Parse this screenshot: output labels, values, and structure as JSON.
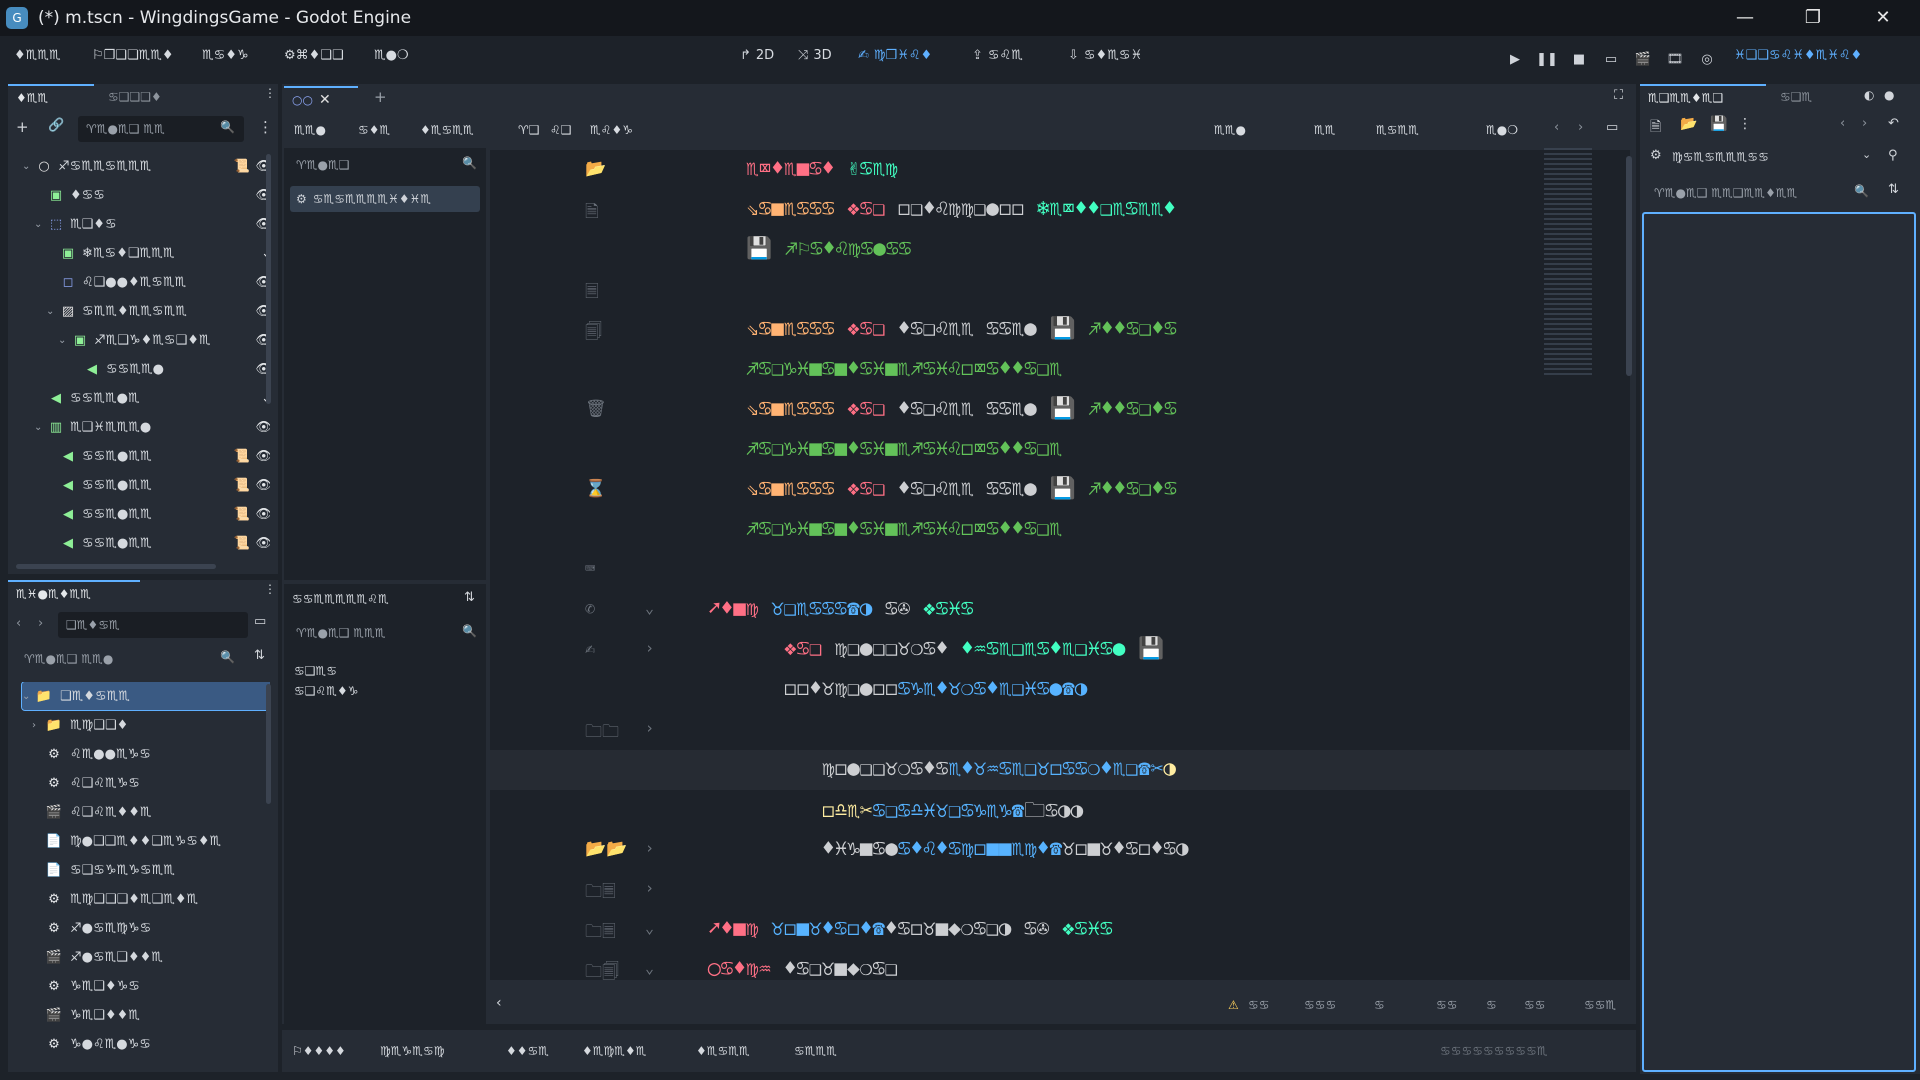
{
  "window": {
    "title": "(*) m.tscn - WingdingsGame - Godot Engine",
    "app_icon": "godot-icon",
    "controls": {
      "minimize": "—",
      "maximize": "❐",
      "close": "✕"
    }
  },
  "menubar": {
    "menus": [
      "♦♏♏♏",
      "⚐❒❑❏♏♏♦",
      "♏♋♦♑",
      "⚙⌘♦❑❑",
      "♏●❍"
    ],
    "workspaces": [
      {
        "icon": "↱",
        "label": "2D"
      },
      {
        "icon": "⤨",
        "label": "3D"
      },
      {
        "icon": "✍",
        "label": "♍❒♓♌♦"
      },
      {
        "icon": "⇪",
        "label": "♋♌♏"
      },
      {
        "icon": "⇩",
        "label": "♋♦♏♋♓"
      }
    ],
    "renderer": "♓❑❑♋♌♓♦♏♓♌♦"
  },
  "colors": {
    "accent": "#5fb0ff",
    "keyword": "#ff7085",
    "string": "#ffeda1",
    "func": "#57b3ff",
    "type": "#42ffc2",
    "orange": "#ffb373",
    "green": "#63c259",
    "comment": "#7b838d"
  },
  "scene_dock": {
    "tabs": [
      "♦♏♏",
      "♋❑❑❑♦"
    ],
    "filter_placeholder": "♈♏●♏❑ ♏♏",
    "nodes": [
      {
        "indent": 0,
        "arrow": "⌄",
        "icon": "○",
        "color": "#e0e0e0",
        "label": "♐♋♏♏♋♏♏♏",
        "extra": "📜",
        "eye": "👁"
      },
      {
        "indent": 1,
        "arrow": "",
        "icon": "▣",
        "color": "#8eef97",
        "label": "♦♋♋",
        "extra": "",
        "eye": "👁"
      },
      {
        "indent": 1,
        "arrow": "⌄",
        "icon": "⬚",
        "color": "#8da5f3",
        "label": "♏❑♦♋",
        "extra": "",
        "eye": "👁"
      },
      {
        "indent": 2,
        "arrow": "",
        "icon": "▣",
        "color": "#8eef97",
        "label": "❄♏♋♦❑♏♏♏",
        "extra": "",
        "eye": "⌄"
      },
      {
        "indent": 2,
        "arrow": "",
        "icon": "◻",
        "color": "#8da5f3",
        "label": "♌❑●●♦♏♋♏♏",
        "extra": "",
        "eye": "👁"
      },
      {
        "indent": 2,
        "arrow": "⌄",
        "icon": "▨",
        "color": "#e0e0e0",
        "label": "♋♏♏♦♏♏♋♏♏",
        "extra": "",
        "eye": "👁"
      },
      {
        "indent": 3,
        "arrow": "⌄",
        "icon": "▣",
        "color": "#8eef97",
        "label": "♐♏❑♑♦♏♋❑♦♏",
        "extra": "",
        "eye": "👁"
      },
      {
        "indent": 4,
        "arrow": "",
        "icon": "◀",
        "color": "#8eef97",
        "label": "♋♋♏♏●",
        "extra": "",
        "eye": "👁"
      },
      {
        "indent": 1,
        "arrow": "",
        "icon": "◀",
        "color": "#8eef97",
        "label": "♋♋♏♏●♏",
        "extra": "",
        "eye": "⌄"
      },
      {
        "indent": 1,
        "arrow": "⌄",
        "icon": "▥",
        "color": "#8eef97",
        "label": "♏❑♓♏♏♏●",
        "extra": "",
        "eye": "👁"
      },
      {
        "indent": 2,
        "arrow": "",
        "icon": "◀",
        "color": "#8eef97",
        "label": "♋♋♏●♏♏",
        "extra": "📜",
        "eye": "👁"
      },
      {
        "indent": 2,
        "arrow": "",
        "icon": "◀",
        "color": "#8eef97",
        "label": "♋♋♏●♏♏",
        "extra": "📜",
        "eye": "👁"
      },
      {
        "indent": 2,
        "arrow": "",
        "icon": "◀",
        "color": "#8eef97",
        "label": "♋♋♏●♏♏",
        "extra": "📜",
        "eye": "👁"
      },
      {
        "indent": 2,
        "arrow": "",
        "icon": "◀",
        "color": "#8eef97",
        "label": "♋♋♏●♏♏",
        "extra": "📜",
        "eye": "👁"
      }
    ]
  },
  "filesystem_dock": {
    "title": "♏♓●♏♦♏♏",
    "path": "❑♏♦♋♏",
    "filter_placeholder": "♈♏●♏❑ ♏♏●",
    "items": [
      {
        "indent": 0,
        "arrow": "⌄",
        "icon": "📁",
        "label": "❑♏♦♋♏♏",
        "selected": true
      },
      {
        "indent": 1,
        "arrow": "›",
        "icon": "📁",
        "label": "♏♍❑❑♦",
        "selected": false
      },
      {
        "indent": 1,
        "arrow": "",
        "icon": "⚙",
        "label": "♌♏●●♏♑♋",
        "selected": false
      },
      {
        "indent": 1,
        "arrow": "",
        "icon": "⚙",
        "label": "♌❑♌♏♑♋",
        "selected": false
      },
      {
        "indent": 1,
        "arrow": "",
        "icon": "🎬",
        "label": "♌❑♌♏♦♦♏",
        "selected": false
      },
      {
        "indent": 1,
        "arrow": "",
        "icon": "📄",
        "label": "♍●❑❑♏♦♦❑♏♑♋♦♏",
        "selected": false
      },
      {
        "indent": 1,
        "arrow": "",
        "icon": "📄",
        "label": "♋❑♋♑♏♑♋♏♏",
        "selected": false
      },
      {
        "indent": 1,
        "arrow": "",
        "icon": "⚙",
        "label": "♏♍❑❑❑♦♏❑♏♦♏",
        "selected": false
      },
      {
        "indent": 1,
        "arrow": "",
        "icon": "⚙",
        "label": "♐●♋♏♍♑♋",
        "selected": false
      },
      {
        "indent": 1,
        "arrow": "",
        "icon": "🎬",
        "label": "♐●♋♏❑♦♦♏",
        "selected": false
      },
      {
        "indent": 1,
        "arrow": "",
        "icon": "⚙",
        "label": "♑♏❑♦♑♋",
        "selected": false
      },
      {
        "indent": 1,
        "arrow": "",
        "icon": "🎬",
        "label": "♑♏❑♦♦♏",
        "selected": false
      },
      {
        "indent": 1,
        "arrow": "",
        "icon": "⚙",
        "label": "♑●♌♏●♑♋",
        "selected": false
      }
    ]
  },
  "script_editor": {
    "tabs": [
      {
        "label": "○○",
        "active": true
      }
    ],
    "toolbar": [
      "♏♏●",
      "♋♦♏",
      "♦♏♋♏♏",
      "♈❑",
      "♌❑",
      "♏♌♦♑"
    ],
    "right_toolbar": [
      "♏♏●",
      "♏♏",
      "♏♋♏♏",
      "♏●❍"
    ],
    "filter_placeholder": "♈♏●♏❑",
    "scripts_list": [
      {
        "label": "♋♏♋♏♏♏♏♓♦♓♏",
        "icon": "⚙"
      }
    ],
    "methods_filter": "♈♏●♏❑ ♏♏♏",
    "methods_header": "♋♋♏♏♏♏♏♌♏",
    "methods": [
      "♋❑♏♋",
      "♋❑♌♏♦♑"
    ]
  },
  "code": {
    "lines": [
      {
        "g1": "📂",
        "g2": "",
        "indent": 2,
        "parts": [
          {
            "t": "♏⌧♦♏■♋♦",
            "c": "keyword"
          },
          {
            "t": "  ✌♋♏♍",
            "c": "type"
          }
        ],
        "hl": false
      },
      {
        "g1": "🗎",
        "g2": "",
        "indent": 2,
        "parts": [
          {
            "t": "⇘♋■♏♋♋♋",
            "c": "orange"
          },
          {
            "t": " ❖♋❑",
            "c": "keyword"
          },
          {
            "t": "  ◻❑♦♌♍♍❑●◻◻",
            "c": "plain"
          },
          {
            "t": "  ❄♏⌧♦♦❑♏♋♏♏♦",
            "c": "type"
          }
        ],
        "hl": false
      },
      {
        "g1": "",
        "g2": "",
        "indent": 2,
        "parts": [
          {
            "t": "💾",
            "c": "plain"
          },
          {
            "t": "  ♐⚐♋♦♌♍♋●♋♋",
            "c": "green"
          }
        ],
        "hl": false
      },
      {
        "g1": "🗏",
        "g2": "",
        "indent": 0,
        "parts": [],
        "hl": false
      },
      {
        "g1": "🗐",
        "g2": "",
        "indent": 2,
        "parts": [
          {
            "t": "⇘♋■♏♋♋♋",
            "c": "orange"
          },
          {
            "t": " ❖♋❑",
            "c": "keyword"
          },
          {
            "t": "  ♦♋❑♌♏♏",
            "c": "plain"
          },
          {
            "t": "  ♋♋♏●",
            "c": "plain"
          },
          {
            "t": "  💾",
            "c": "plain"
          },
          {
            "t": "  ♐♦♦♋❑♦♋",
            "c": "green"
          }
        ],
        "hl": false
      },
      {
        "g1": "",
        "g2": "",
        "indent": 2,
        "parts": [
          {
            "t": "♐♋❑♑♓■♋■♦♋♓■♏♐♋♓♌◻⌧♋♦♦♋❑♏",
            "c": "green"
          }
        ],
        "hl": false
      },
      {
        "g1": "🗑",
        "g2": "",
        "indent": 2,
        "parts": [
          {
            "t": "⇘♋■♏♋♋♋",
            "c": "orange"
          },
          {
            "t": " ❖♋❑",
            "c": "keyword"
          },
          {
            "t": "  ♦♋❑♌♏♏",
            "c": "plain"
          },
          {
            "t": "  ♋♋♏●",
            "c": "plain"
          },
          {
            "t": "  💾",
            "c": "plain"
          },
          {
            "t": "  ♐♦♦♋❑♦♋",
            "c": "green"
          }
        ],
        "hl": false
      },
      {
        "g1": "",
        "g2": "",
        "indent": 2,
        "parts": [
          {
            "t": "♐♋❑♑♓■♋■♦♋♓■♏♐♋♓♌◻⌧♋♦♦♋❑♏",
            "c": "green"
          }
        ],
        "hl": false
      },
      {
        "g1": "⌛",
        "g2": "",
        "indent": 2,
        "parts": [
          {
            "t": "⇘♋■♏♋♋♋",
            "c": "orange"
          },
          {
            "t": " ❖♋❑",
            "c": "keyword"
          },
          {
            "t": "  ♦♋❑♌♏♏",
            "c": "plain"
          },
          {
            "t": "  ♋♋♏●",
            "c": "plain"
          },
          {
            "t": "  💾",
            "c": "plain"
          },
          {
            "t": "  ♐♦♦♋❑♦♋",
            "c": "green"
          }
        ],
        "hl": false
      },
      {
        "g1": "",
        "g2": "",
        "indent": 2,
        "parts": [
          {
            "t": "♐♋❑♑♓■♋■♦♋♓■♏♐♋♓♌◻⌧♋♦♦♋❑♏",
            "c": "green"
          }
        ],
        "hl": false
      },
      {
        "g1": "⌨",
        "g2": "",
        "indent": 0,
        "parts": [],
        "hl": false
      },
      {
        "g1": "✆",
        "g2": "⌄",
        "indent": 1,
        "parts": [
          {
            "t": "➚♦■♍",
            "c": "keyword"
          },
          {
            "t": "  ♉❑♏♋♋♋☎◑",
            "c": "func"
          },
          {
            "t": "  ♋✇",
            "c": "plain"
          },
          {
            "t": "  ❖♋♓♋",
            "c": "type"
          }
        ],
        "hl": false
      },
      {
        "g1": "✍",
        "g2": "›",
        "indent": 3,
        "parts": [
          {
            "t": "❖♋❑",
            "c": "keyword"
          },
          {
            "t": "  ♍❑●❑❑♉❍♋♦",
            "c": "plain"
          },
          {
            "t": "  ♦♒♋♏❑♏♋♦♏❑♓♋●",
            "c": "type"
          },
          {
            "t": "  💾",
            "c": "plain"
          }
        ],
        "hl": false
      },
      {
        "g1": "",
        "g2": "",
        "indent": 3,
        "parts": [
          {
            "t": "◻◻♦♉♍❑●◻◻",
            "c": "plain"
          },
          {
            "t": "♋♑♏♦♉❍♋♦♏❑♓♋●☎◑",
            "c": "func"
          }
        ],
        "hl": false
      },
      {
        "g1": "🗀🗀",
        "g2": "›",
        "indent": 0,
        "parts": [],
        "hl": false
      },
      {
        "g1": "",
        "g2": "",
        "indent": 4,
        "parts": [
          {
            "t": "♍◻●❑❑♉❍♋♦♋",
            "c": "plain"
          },
          {
            "t": "♏♦♉♒♋♏❑♉◻♋♋❍♦♏❑☎✂",
            "c": "func"
          },
          {
            "t": "◑",
            "c": "string"
          }
        ],
        "hl": true
      },
      {
        "g1": "",
        "g2": "",
        "indent": 4,
        "parts": [
          {
            "t": "◻♎♏✂",
            "c": "string"
          },
          {
            "t": "♋❑♋♎♓♉❑♋♑♏♑☎",
            "c": "func"
          },
          {
            "t": "🗀♋◑◑",
            "c": "plain"
          }
        ],
        "hl": false
      },
      {
        "g1": "📂📂",
        "g2": "›",
        "indent": 4,
        "parts": [
          {
            "t": "♦♓♑■♋●",
            "c": "plain"
          },
          {
            "t": "♋♦♌♦♋♍◻■■♏♍♦☎",
            "c": "func"
          },
          {
            "t": "♉◻■♉♦♋◻♦♋◑",
            "c": "plain"
          }
        ],
        "hl": false
      },
      {
        "g1": "🗀🗏",
        "g2": "›",
        "indent": 0,
        "parts": [],
        "hl": false
      },
      {
        "g1": "🗀🗏",
        "g2": "⌄",
        "indent": 1,
        "parts": [
          {
            "t": "➚♦■♍",
            "c": "keyword"
          },
          {
            "t": "  ♉◻■♉♦♋◻♦☎",
            "c": "func"
          },
          {
            "t": "♦♋◻♉■◆❍♋❑◑",
            "c": "plain"
          },
          {
            "t": "  ♋✇",
            "c": "plain"
          },
          {
            "t": "  ❖♋♓♋",
            "c": "type"
          }
        ],
        "hl": false
      },
      {
        "g1": "🗀🗐",
        "g2": "⌄",
        "indent": 1,
        "parts": [
          {
            "t": "◯♋♦♍♒",
            "c": "keyword"
          },
          {
            "t": "  ♦♋❑♉■◆❍♋❑",
            "c": "plain"
          }
        ],
        "hl": false
      }
    ]
  },
  "code_statusbar": {
    "warnings": "⚠",
    "items": [
      "♋♋",
      "♋♋♋",
      "♋",
      "♋♋",
      "♋",
      "♋♋",
      "♋♋♏"
    ]
  },
  "bottom_panel": {
    "tabs": [
      "⚐♦♦♦♦",
      "♍♏♑♏♋♍",
      "♦♦♋♏",
      "♦♏♍♏♦♏",
      "♦♏♋♏♏",
      "♋♏♏♏"
    ],
    "version": "♋♋♋♋♋♋♋♋♋♏"
  },
  "inspector_dock": {
    "tabs": [
      "♏❑♏♏♦♏❑",
      "♋❑♏"
    ],
    "node_label": "♍♋♏♋♏♏♏♋♋",
    "filter_placeholder": "♈♏●♏❑ ♏♏❑♏♏♦♏♏"
  }
}
